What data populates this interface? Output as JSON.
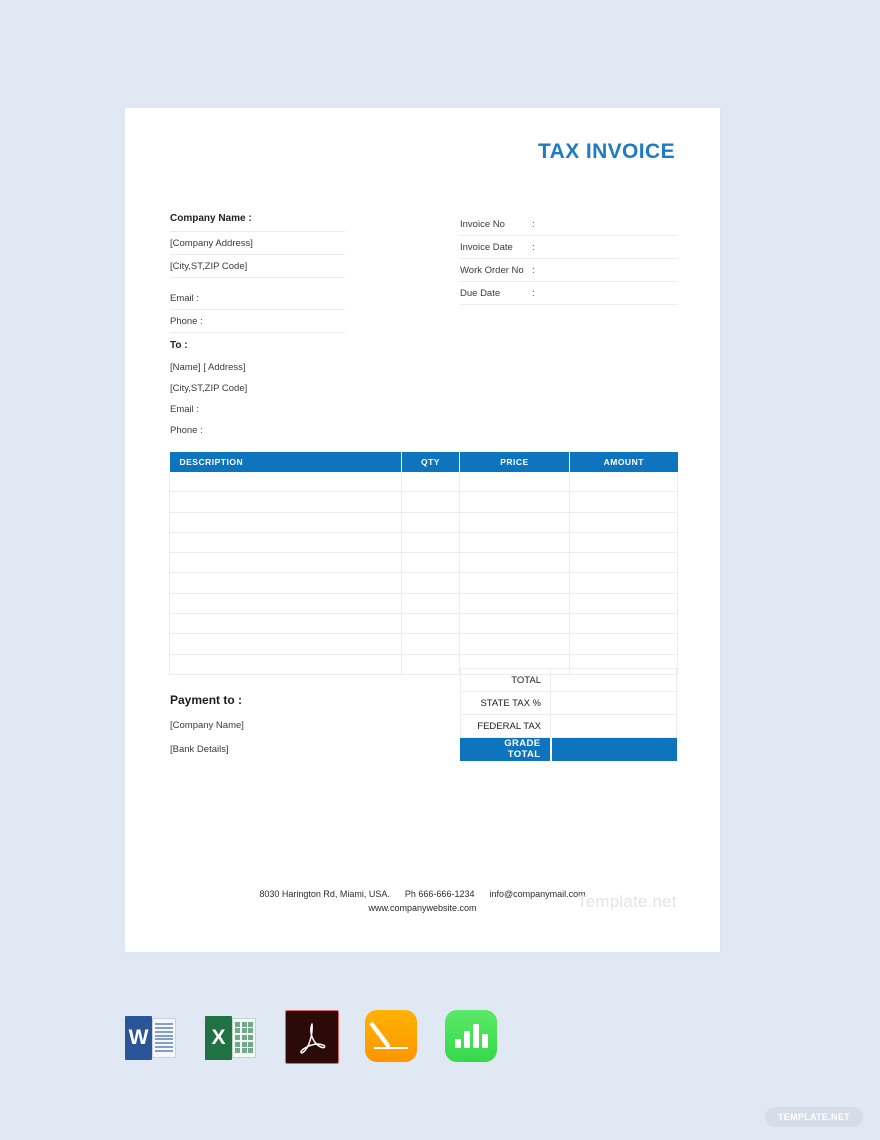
{
  "page": {
    "background_color": "#e0e8f3",
    "accent_color": "#0f74be",
    "title_color": "#1e7bc4"
  },
  "document": {
    "title": "TAX INVOICE"
  },
  "company": {
    "name_label": "Company Name :",
    "address": "[Company Address]",
    "city_state_zip": "[City,ST,ZIP Code]",
    "email_label": "Email   :",
    "phone_label": "Phone  :"
  },
  "invoice_meta": {
    "rows": [
      {
        "label": "Invoice No",
        "colon": ":",
        "value": ""
      },
      {
        "label": "Invoice Date",
        "colon": ":",
        "value": ""
      },
      {
        "label": "Work Order No",
        "colon": ":",
        "value": ""
      },
      {
        "label": "Due Date",
        "colon": ":",
        "value": ""
      }
    ]
  },
  "bill_to": {
    "title": "To :",
    "name_address": "[Name] [ Address]",
    "city_state_zip": "[City,ST,ZIP Code]",
    "email_label": "Email   :",
    "phone_label": "Phone  :"
  },
  "items_table": {
    "headers": [
      "DESCRIPTION",
      "QTY",
      "PRICE",
      "AMOUNT"
    ],
    "empty_row_count": 10,
    "rows": [
      {
        "description": "",
        "qty": "",
        "price": "",
        "amount": ""
      },
      {
        "description": "",
        "qty": "",
        "price": "",
        "amount": ""
      },
      {
        "description": "",
        "qty": "",
        "price": "",
        "amount": ""
      },
      {
        "description": "",
        "qty": "",
        "price": "",
        "amount": ""
      },
      {
        "description": "",
        "qty": "",
        "price": "",
        "amount": ""
      },
      {
        "description": "",
        "qty": "",
        "price": "",
        "amount": ""
      },
      {
        "description": "",
        "qty": "",
        "price": "",
        "amount": ""
      },
      {
        "description": "",
        "qty": "",
        "price": "",
        "amount": ""
      },
      {
        "description": "",
        "qty": "",
        "price": "",
        "amount": ""
      },
      {
        "description": "",
        "qty": "",
        "price": "",
        "amount": ""
      }
    ]
  },
  "totals": {
    "rows": [
      {
        "label": "TOTAL",
        "value": ""
      },
      {
        "label": "STATE TAX %",
        "value": ""
      },
      {
        "label": "FEDERAL TAX",
        "value": ""
      }
    ],
    "grand": {
      "label": "GRADE TOTAL",
      "value": ""
    }
  },
  "payment": {
    "title": "Payment to :",
    "company": "[Company Name]",
    "bank": "[Bank Details]"
  },
  "footer": {
    "address": "8030 Harington Rd, Miami, USA.",
    "phone": "Ph 666-666-1234",
    "email": "info@companymail.com",
    "website": "www.companywebsite.com",
    "watermark": "Template.net"
  },
  "formats": [
    {
      "name": "word",
      "letter": "W"
    },
    {
      "name": "excel",
      "letter": "X"
    },
    {
      "name": "pdf",
      "letter": ""
    },
    {
      "name": "pages",
      "letter": ""
    },
    {
      "name": "numbers",
      "letter": ""
    }
  ],
  "badge": {
    "label": "TEMPLATE.NET"
  }
}
